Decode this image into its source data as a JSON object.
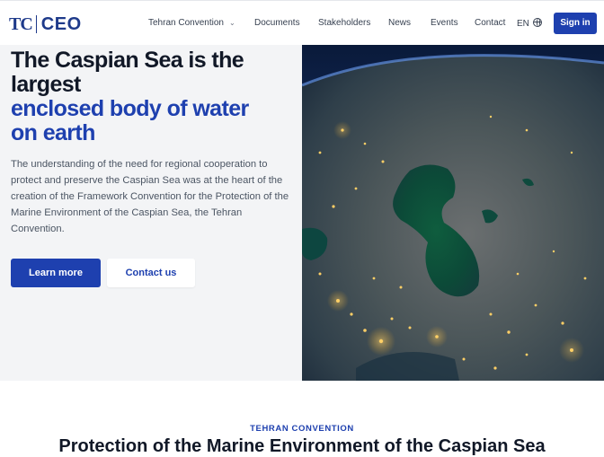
{
  "header": {
    "logo_tc": "TC",
    "logo_ceo": "CEO",
    "nav": [
      {
        "label": "Tehran Convention",
        "has_dropdown": true
      },
      {
        "label": "Documents"
      },
      {
        "label": "Stakeholders"
      },
      {
        "label": "News"
      },
      {
        "label": "Events"
      },
      {
        "label": "Contact"
      }
    ],
    "language": "EN",
    "signin_label": "Sign in"
  },
  "hero": {
    "title_line1": "The Caspian Sea is the",
    "title_line2": "largest",
    "title_line3": "enclosed body of water",
    "title_line4": "on earth",
    "description": "The understanding of the need for regional cooperation to protect and preserve the Caspian Sea was at the heart of the creation of the Framework Convention for the Protection of the Marine Environment of the Caspian Sea, the Tehran Convention.",
    "primary_button": "Learn more",
    "secondary_button": "Contact us",
    "image_icon": "earth-night-satellite-image"
  },
  "section": {
    "eyebrow": "TEHRAN CONVENTION",
    "title": "Protection of the Marine Environment of the Caspian Sea"
  },
  "colors": {
    "brand_blue": "#1e40af",
    "hero_bg": "#f3f4f6"
  }
}
